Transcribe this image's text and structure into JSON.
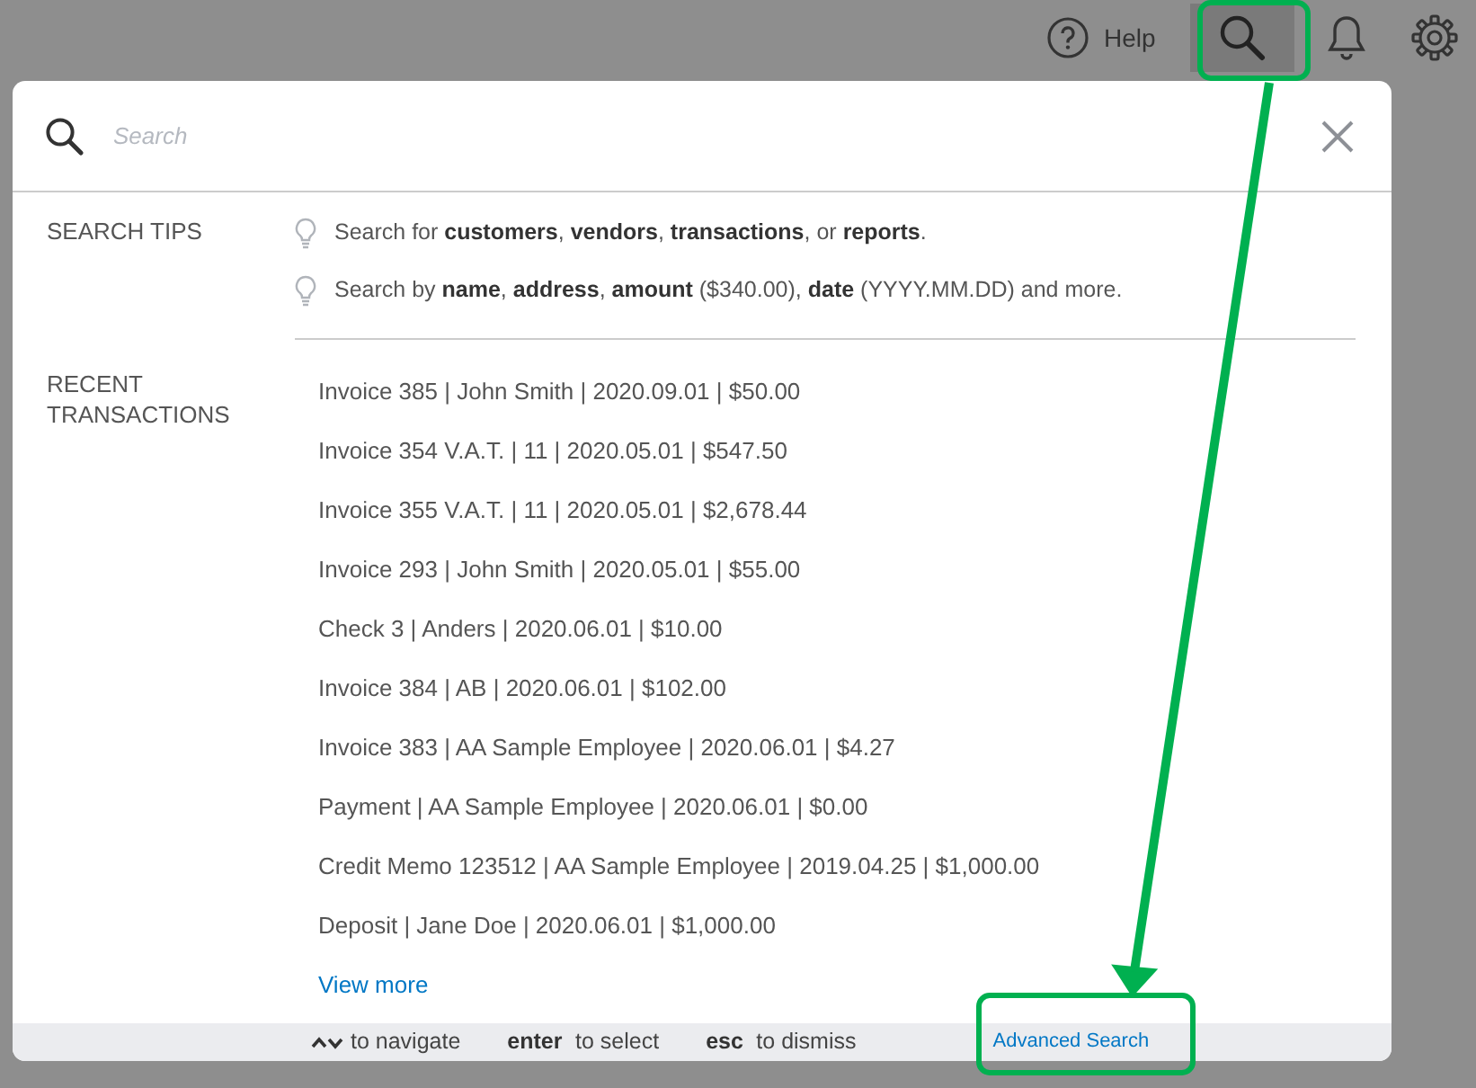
{
  "topbar": {
    "help_label": "Help",
    "search_selected": true
  },
  "search": {
    "placeholder": "Search"
  },
  "tips": {
    "label": "SEARCH TIPS",
    "items": [
      "Search for **customers**, **vendors**, **transactions**, or **reports**.",
      "Search by **name**, **address**, **amount** ($340.00), **date** (YYYY.MM.DD) and more."
    ]
  },
  "recent": {
    "label": "RECENT TRANSACTIONS",
    "items": [
      "Invoice 385 | John Smith | 2020.09.01 | $50.00",
      "Invoice 354 V.A.T. | 11 | 2020.05.01 | $547.50",
      "Invoice 355 V.A.T. | 11 | 2020.05.01 | $2,678.44",
      "Invoice 293 | John Smith | 2020.05.01 | $55.00",
      "Check 3 | Anders | 2020.06.01 | $10.00",
      "Invoice 384 | AB | 2020.06.01 | $102.00",
      "Invoice 383 | AA Sample Employee | 2020.06.01 | $4.27",
      "Payment  | AA Sample Employee | 2020.06.01 | $0.00",
      "Credit Memo 123512 | AA Sample Employee | 2019.04.25 | $1,000.00",
      "Deposit  | Jane Doe | 2020.06.01 | $1,000.00"
    ],
    "view_more": "View more"
  },
  "footer": {
    "hints": [
      {
        "kind": "arrows",
        "text": "to navigate"
      },
      {
        "kind": "key",
        "key": "enter",
        "text": "to select"
      },
      {
        "kind": "key",
        "key": "esc",
        "text": "to dismiss"
      }
    ],
    "advanced_search": "Advanced Search"
  }
}
